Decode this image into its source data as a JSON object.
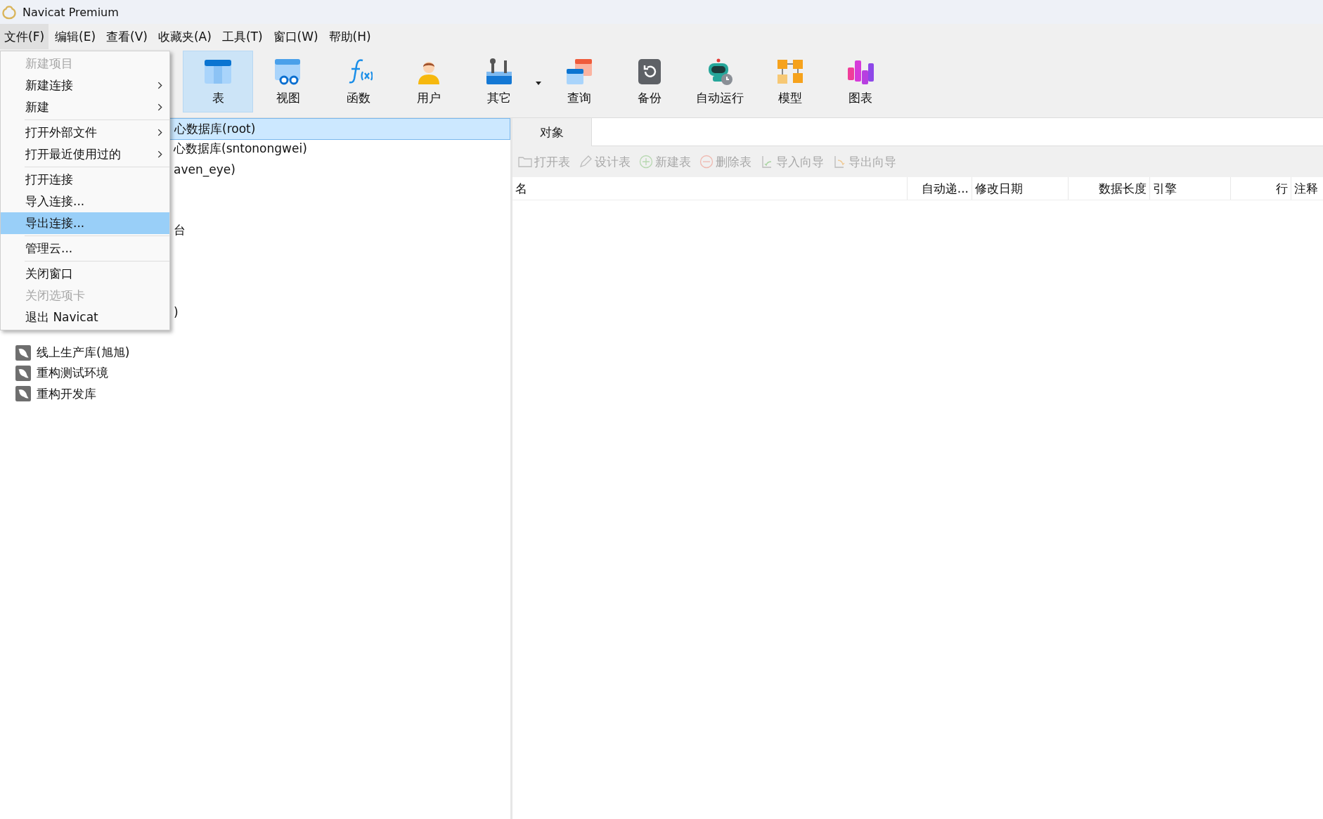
{
  "window": {
    "title": "Navicat Premium"
  },
  "menubar": [
    {
      "label": "文件(F)",
      "selected": true
    },
    {
      "label": "编辑(E)",
      "selected": false
    },
    {
      "label": "查看(V)",
      "selected": false
    },
    {
      "label": "收藏夹(A)",
      "selected": false
    },
    {
      "label": "工具(T)",
      "selected": false
    },
    {
      "label": "窗口(W)",
      "selected": false
    },
    {
      "label": "帮助(H)",
      "selected": false
    }
  ],
  "toolbar": [
    {
      "kind": "table",
      "label": "表",
      "selected": true,
      "dropdown": false
    },
    {
      "kind": "view",
      "label": "视图",
      "selected": false,
      "dropdown": false
    },
    {
      "kind": "function",
      "label": "函数",
      "selected": false,
      "dropdown": false
    },
    {
      "kind": "user",
      "label": "用户",
      "selected": false,
      "dropdown": false
    },
    {
      "kind": "other",
      "label": "其它",
      "selected": false,
      "dropdown": true
    },
    {
      "kind": "query",
      "label": "查询",
      "selected": false,
      "dropdown": false
    },
    {
      "kind": "backup",
      "label": "备份",
      "selected": false,
      "dropdown": false
    },
    {
      "kind": "automation",
      "label": "自动运行",
      "selected": false,
      "dropdown": false
    },
    {
      "kind": "model",
      "label": "模型",
      "selected": false,
      "dropdown": false
    },
    {
      "kind": "chart",
      "label": "图表",
      "selected": false,
      "dropdown": false
    }
  ],
  "file_menu": [
    {
      "kind": "item",
      "label": "新建项目",
      "disabled": true,
      "submenu": false,
      "selected": false
    },
    {
      "kind": "item",
      "label": "新建连接",
      "disabled": false,
      "submenu": true,
      "selected": false
    },
    {
      "kind": "item",
      "label": "新建",
      "disabled": false,
      "submenu": true,
      "selected": false
    },
    {
      "kind": "separator"
    },
    {
      "kind": "item",
      "label": "打开外部文件",
      "disabled": false,
      "submenu": true,
      "selected": false
    },
    {
      "kind": "item",
      "label": "打开最近使用过的",
      "disabled": false,
      "submenu": true,
      "selected": false
    },
    {
      "kind": "separator"
    },
    {
      "kind": "item",
      "label": "打开连接",
      "disabled": false,
      "submenu": false,
      "selected": false
    },
    {
      "kind": "item",
      "label": "导入连接...",
      "disabled": false,
      "submenu": false,
      "selected": false
    },
    {
      "kind": "item",
      "label": "导出连接...",
      "disabled": false,
      "submenu": false,
      "selected": true
    },
    {
      "kind": "separator"
    },
    {
      "kind": "item",
      "label": "管理云...",
      "disabled": false,
      "submenu": false,
      "selected": false
    },
    {
      "kind": "separator"
    },
    {
      "kind": "item",
      "label": "关闭窗口",
      "disabled": false,
      "submenu": false,
      "selected": false
    },
    {
      "kind": "item",
      "label": "关闭选项卡",
      "disabled": true,
      "submenu": false,
      "selected": false
    },
    {
      "kind": "item",
      "label": "退出 Navicat",
      "disabled": false,
      "submenu": false,
      "selected": false
    }
  ],
  "tree": [
    {
      "kind": "fragment",
      "label": "心数据库(root)",
      "selected": true
    },
    {
      "kind": "fragment",
      "label": "心数据库(sntonongwei)",
      "selected": false
    },
    {
      "kind": "fragment",
      "label": "aven_eye)",
      "selected": false
    },
    {
      "kind": "fragment",
      "label": "台",
      "selected": false
    },
    {
      "kind": "fragment",
      "label": ")",
      "selected": false
    },
    {
      "kind": "connection",
      "label": "线上生产库(旭旭)",
      "selected": false
    },
    {
      "kind": "connection",
      "label": "重构测试环境",
      "selected": false
    },
    {
      "kind": "connection",
      "label": "重构开发库",
      "selected": false
    }
  ],
  "tabs": [
    {
      "label": "对象",
      "selected": true
    }
  ],
  "actions": [
    {
      "kind": "open",
      "label": "打开表",
      "disabled": true
    },
    {
      "kind": "design",
      "label": "设计表",
      "disabled": true
    },
    {
      "kind": "add",
      "label": "新建表",
      "disabled": true
    },
    {
      "kind": "remove",
      "label": "删除表",
      "disabled": true
    },
    {
      "kind": "import",
      "label": "导入向导",
      "disabled": true
    },
    {
      "kind": "export",
      "label": "导出向导",
      "disabled": true
    }
  ],
  "table": {
    "columns": [
      "名",
      "自动递...",
      "修改日期",
      "数据长度",
      "引擎",
      "行",
      "注释"
    ]
  }
}
